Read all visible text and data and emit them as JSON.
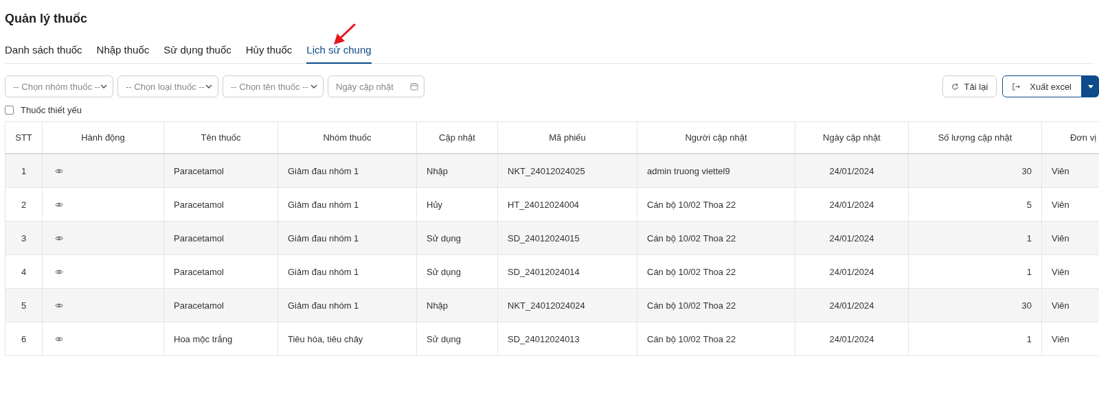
{
  "page": {
    "title": "Quản lý thuốc"
  },
  "tabs": [
    {
      "label": "Danh sách thuốc",
      "selected": false
    },
    {
      "label": "Nhập thuốc",
      "selected": false
    },
    {
      "label": "Sử dụng thuốc",
      "selected": false
    },
    {
      "label": "Hủy thuốc",
      "selected": false
    },
    {
      "label": "Lịch sử chung",
      "selected": true
    }
  ],
  "filters": [
    {
      "kind": "select",
      "placeholder": "-- Chọn nhóm thuốc --"
    },
    {
      "kind": "select",
      "placeholder": "-- Chọn loại thuốc --"
    },
    {
      "kind": "select",
      "placeholder": "-- Chọn tên thuốc --"
    },
    {
      "kind": "date",
      "placeholder": "Ngày cập nhật"
    }
  ],
  "buttons": [
    {
      "kind": "reload",
      "label": "Tải lại"
    },
    {
      "kind": "export",
      "label": "Xuất excel"
    }
  ],
  "essential_filter": {
    "label": "Thuốc thiết yếu",
    "checked": false
  },
  "table": {
    "columns": [
      "STT",
      "Hành động",
      "Tên thuốc",
      "Nhóm thuốc",
      "Cập nhật",
      "Mã phiếu",
      "Người cập nhật",
      "Ngày cập nhật",
      "Số lượng cập nhật",
      "Đơn vị"
    ],
    "rows": [
      [
        "1",
        "",
        "Paracetamol",
        "Giảm đau nhóm 1",
        "Nhập",
        "NKT_24012024025",
        "admin truong viettel9",
        "24/01/2024",
        "30",
        "Viên"
      ],
      [
        "2",
        "",
        "Paracetamol",
        "Giảm đau nhóm 1",
        "Hủy",
        "HT_24012024004",
        "Cán bộ 10/02 Thoa 22",
        "24/01/2024",
        "5",
        "Viên"
      ],
      [
        "3",
        "",
        "Paracetamol",
        "Giảm đau nhóm 1",
        "Sử dụng",
        "SD_24012024015",
        "Cán bộ 10/02 Thoa 22",
        "24/01/2024",
        "1",
        "Viên"
      ],
      [
        "4",
        "",
        "Paracetamol",
        "Giảm đau nhóm 1",
        "Sử dụng",
        "SD_24012024014",
        "Cán bộ 10/02 Thoa 22",
        "24/01/2024",
        "1",
        "Viên"
      ],
      [
        "5",
        "",
        "Paracetamol",
        "Giảm đau nhóm 1",
        "Nhập",
        "NKT_24012024024",
        "Cán bộ 10/02 Thoa 22",
        "24/01/2024",
        "30",
        "Viên"
      ],
      [
        "6",
        "",
        "Hoa mộc trắng",
        "Tiêu hóa, tiêu chảy",
        "Sử dụng",
        "SD_24012024013",
        "Cán bộ 10/02 Thoa 22",
        "24/01/2024",
        "1",
        "Viên"
      ]
    ]
  }
}
